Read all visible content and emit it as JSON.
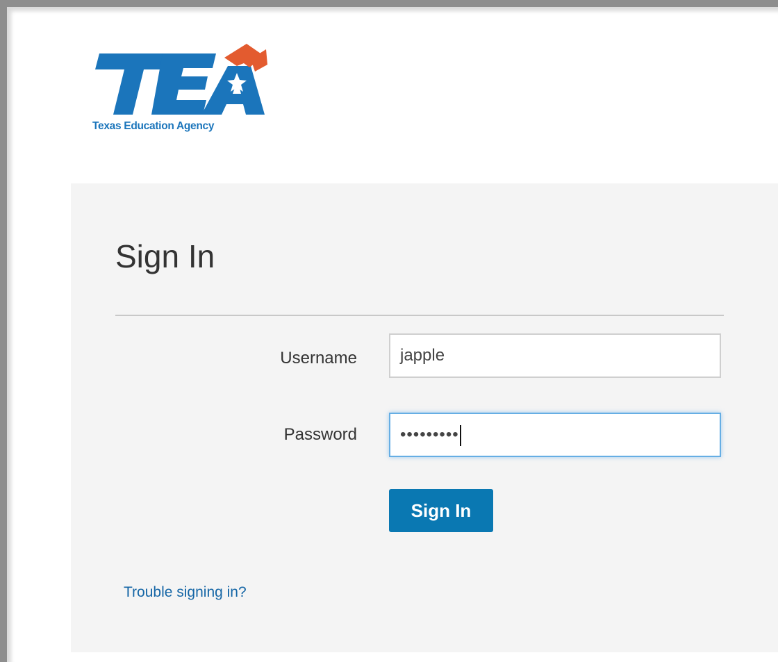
{
  "logo": {
    "wordmark": "TEA",
    "tagline": "Texas Education Agency",
    "colors": {
      "blue": "#1b75bb",
      "orange": "#e35b2f"
    }
  },
  "signin": {
    "title": "Sign In",
    "username_label": "Username",
    "username_value": "japple",
    "password_label": "Password",
    "password_value": "•••••••••",
    "submit_label": "Sign In",
    "trouble_link": "Trouble signing in?"
  },
  "colors": {
    "panel_bg": "#f4f4f4",
    "button_bg": "#0a78b2",
    "link": "#1566a6",
    "focus_border": "#66aee4"
  }
}
